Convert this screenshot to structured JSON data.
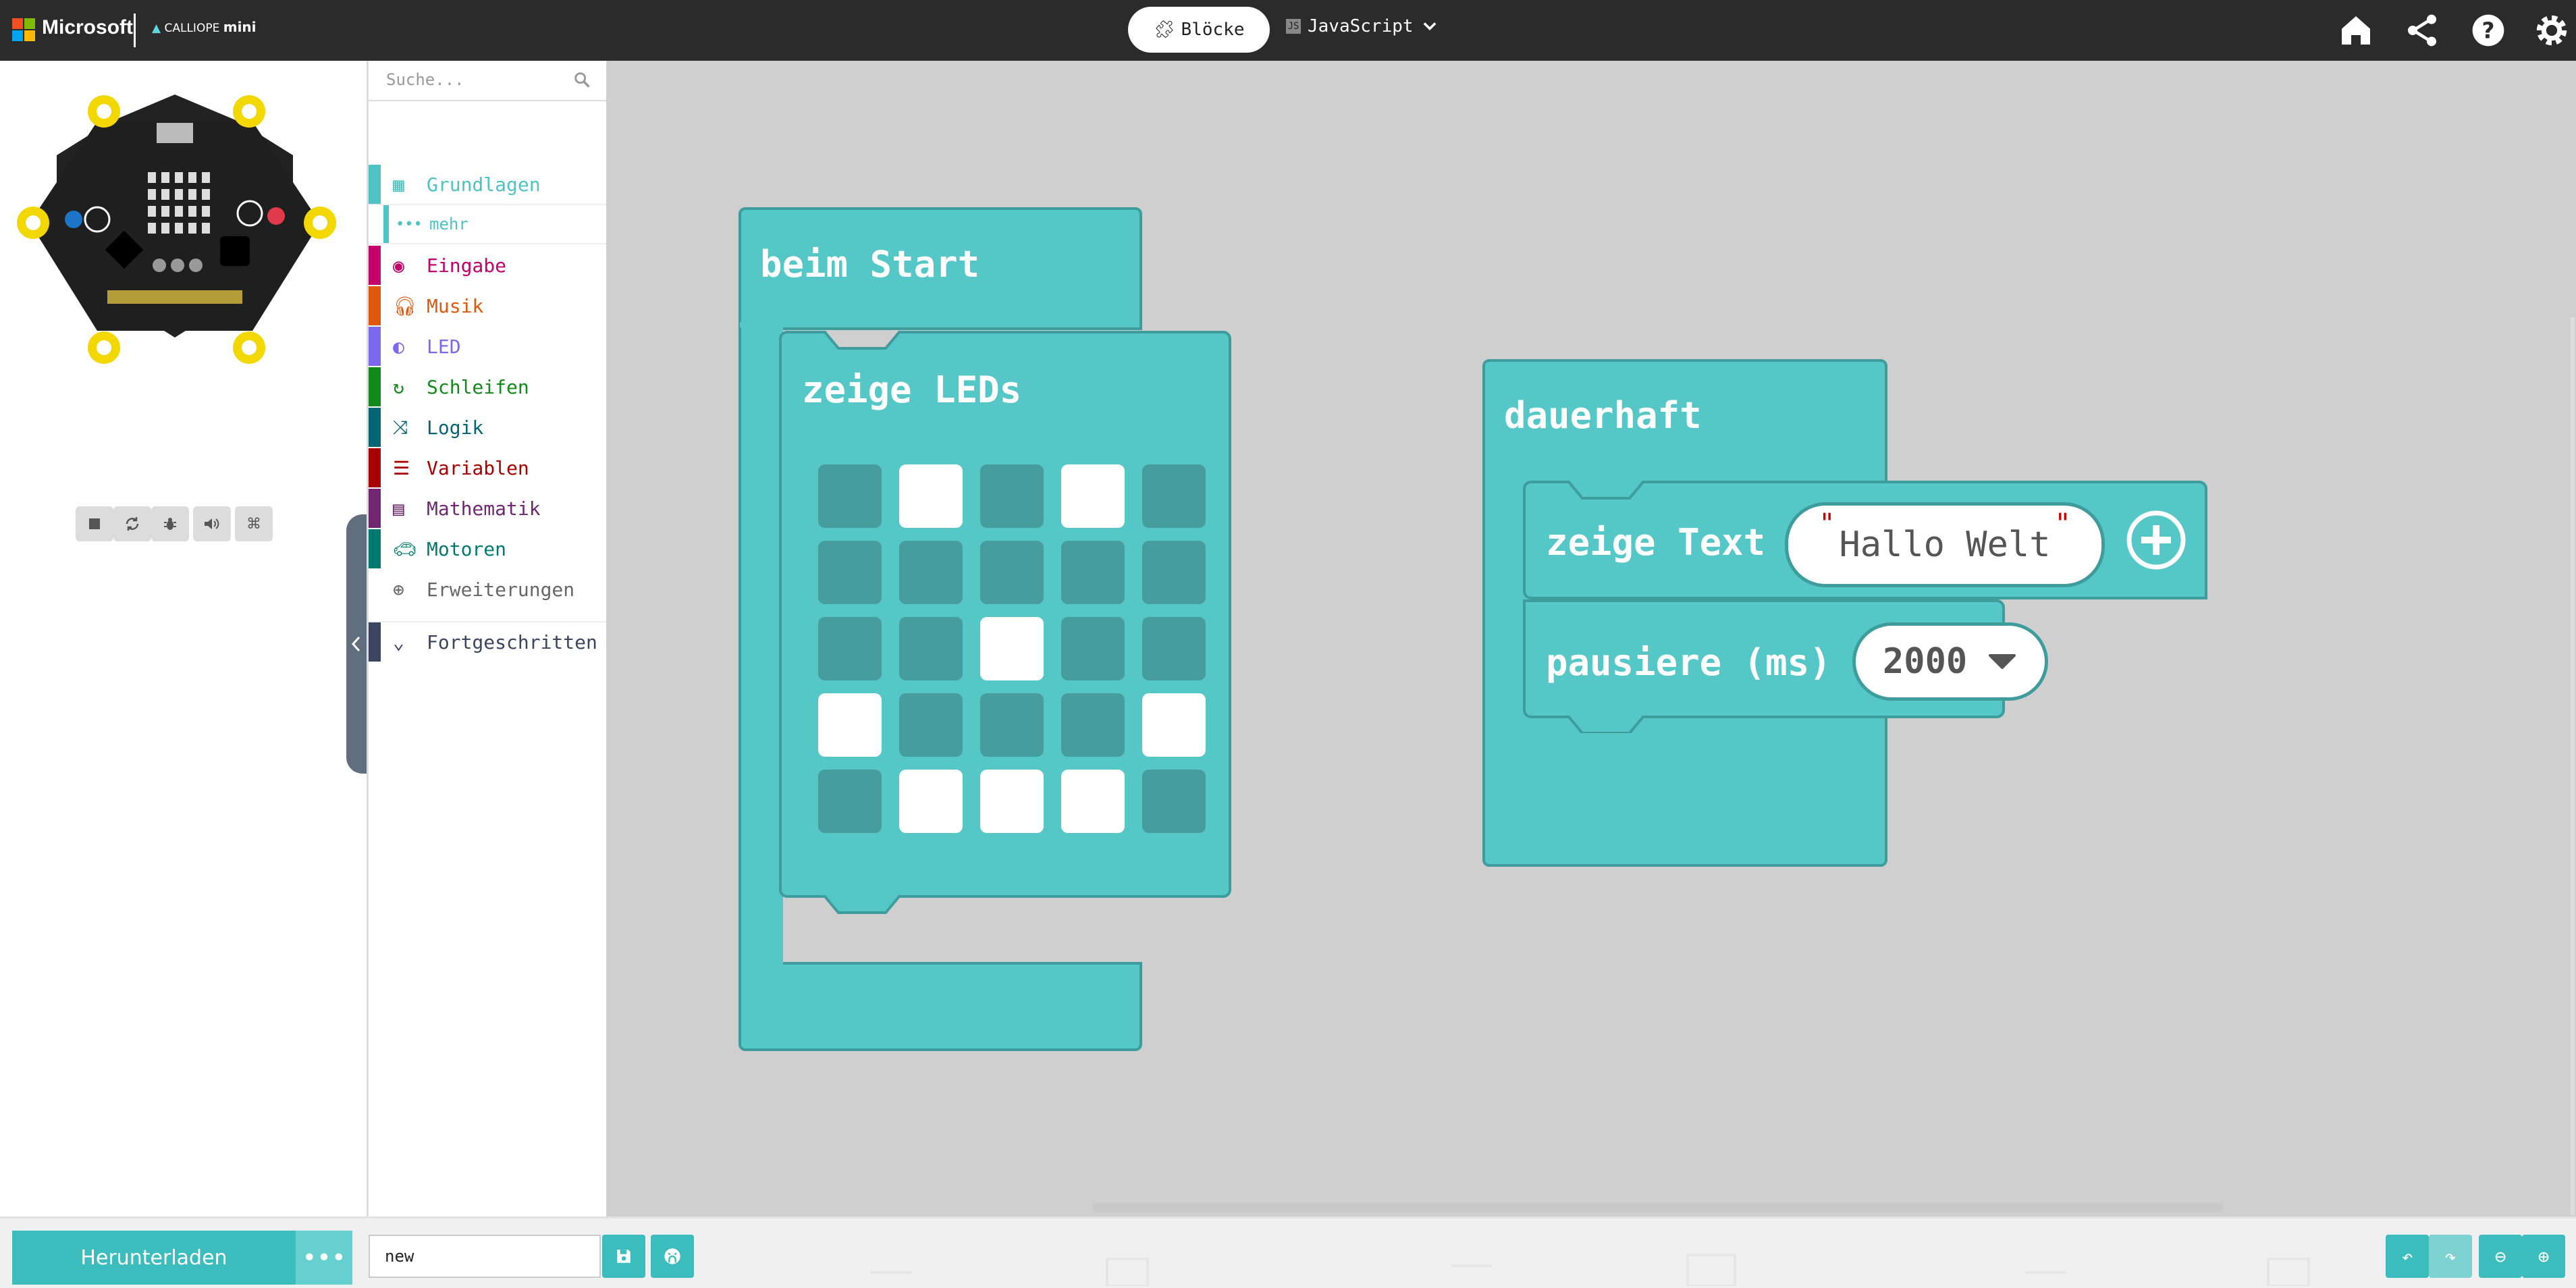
{
  "header": {
    "brand": "Microsoft",
    "product_small": "CALLIOPE",
    "product_big": "mini",
    "blocks_label": "Blöcke",
    "js_label": "JavaScript"
  },
  "toolbox": {
    "search_placeholder": "Suche...",
    "categories": [
      {
        "label": "Grundlagen",
        "color": "#4fc3c3"
      },
      {
        "label": "mehr",
        "color": "#4fc3c3"
      },
      {
        "label": "Eingabe",
        "color": "#c3006b"
      },
      {
        "label": "Musik",
        "color": "#e0580b"
      },
      {
        "label": "LED",
        "color": "#7c68ee"
      },
      {
        "label": "Schleifen",
        "color": "#118a1a"
      },
      {
        "label": "Logik",
        "color": "#066575"
      },
      {
        "label": "Variablen",
        "color": "#a80000"
      },
      {
        "label": "Mathematik",
        "color": "#712672"
      },
      {
        "label": "Motoren",
        "color": "#007a6e"
      },
      {
        "label": "Erweiterungen",
        "color": "#666666"
      },
      {
        "label": "Fortgeschritten",
        "color": "#3c4560"
      }
    ]
  },
  "blocks": {
    "on_start": "beim Start",
    "show_leds": "zeige LEDs",
    "leds": [
      [
        0,
        1,
        0,
        1,
        0
      ],
      [
        0,
        0,
        0,
        0,
        0
      ],
      [
        0,
        0,
        1,
        0,
        0
      ],
      [
        1,
        0,
        0,
        0,
        1
      ],
      [
        0,
        1,
        1,
        1,
        0
      ]
    ],
    "forever": "dauerhaft",
    "show_text": "zeige Text",
    "text_value": "Hallo Welt",
    "pause": "pausiere (ms)",
    "pause_value": "2000"
  },
  "bottom": {
    "download": "Herunterladen",
    "project_name": "new"
  },
  "colors": {
    "block": "#55c7c7",
    "block_border": "#3e9c9c",
    "led_off": "#479d9d",
    "led_on": "#ffffff",
    "header_bg": "#2b2b2b"
  }
}
